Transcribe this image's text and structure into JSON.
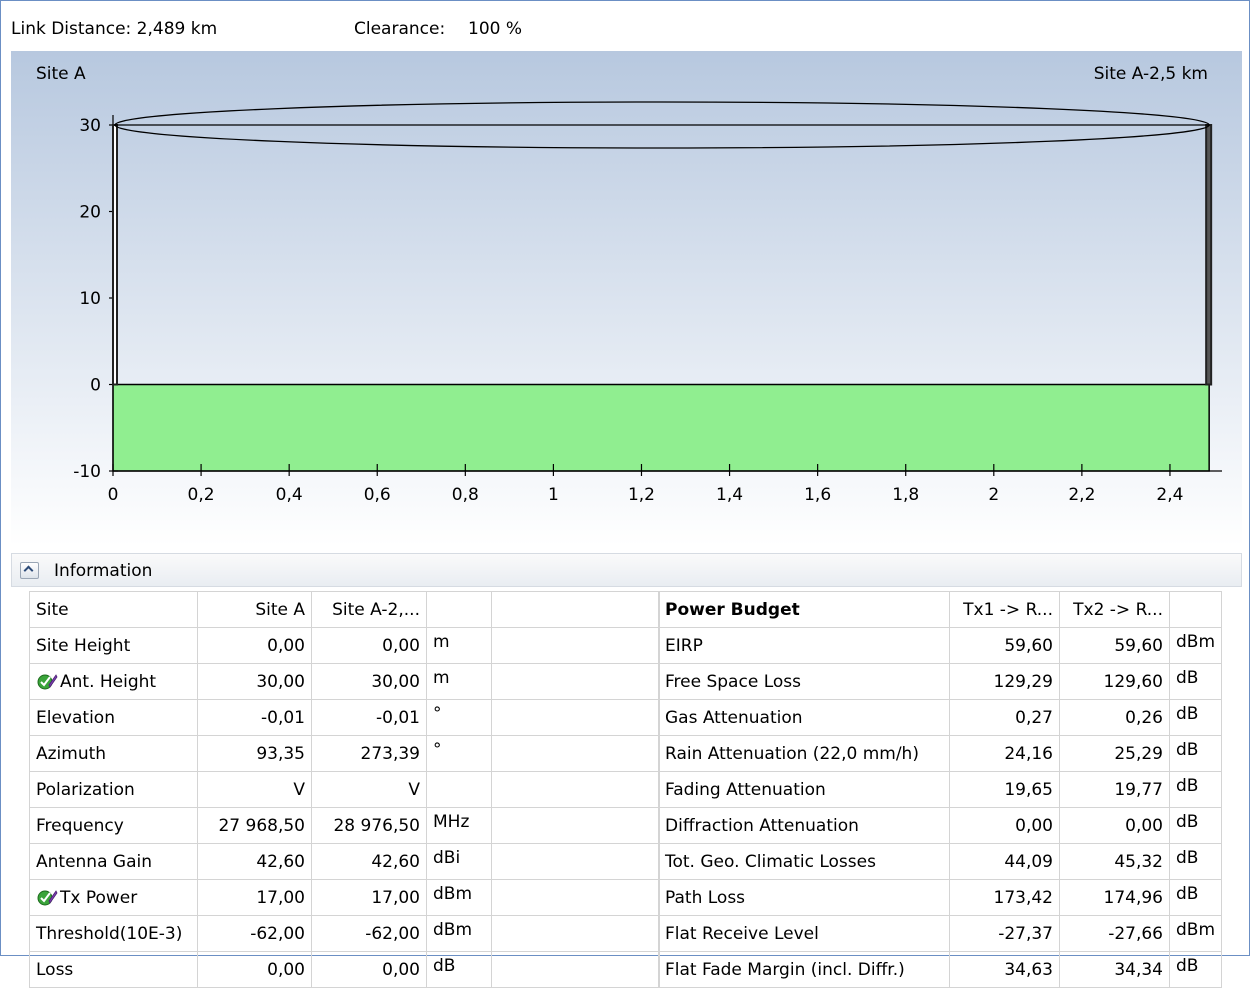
{
  "header": {
    "link_distance": "Link Distance: 2,489 km",
    "clearance_label": "Clearance:",
    "clearance_value": "100 %"
  },
  "chart_data": {
    "type": "area",
    "site_left_label": "Site A",
    "site_right_label": "Site A-2,5 km",
    "x_ticks": [
      "0",
      "0,2",
      "0,4",
      "0,6",
      "0,8",
      "1",
      "1,2",
      "1,4",
      "1,6",
      "1,8",
      "2",
      "2,2",
      "2,4"
    ],
    "y_ticks": [
      "30",
      "20",
      "10",
      "0",
      "-10"
    ],
    "xlim": [
      0,
      2.5
    ],
    "ylim": [
      -10,
      30
    ],
    "terrain": {
      "x": [
        0,
        2.489
      ],
      "y": [
        0,
        0
      ]
    },
    "antenna_height_a": 30,
    "antenna_height_b": 30,
    "link_length": 2.489,
    "colors": {
      "terrain": "#90ee90",
      "background_top": "#b7c8df",
      "background_bottom": "#ffffff"
    }
  },
  "info": {
    "title": "Information",
    "site_table": {
      "rows": [
        {
          "label": "Site",
          "a": "Site A",
          "b": "Site A-2,...",
          "unit": ""
        },
        {
          "label": "Site Height",
          "a": "0,00",
          "b": "0,00",
          "unit": "m"
        },
        {
          "label": "Ant. Height",
          "a": "30,00",
          "b": "30,00",
          "unit": "m",
          "icon": "check-edit-icon"
        },
        {
          "label": "Elevation",
          "a": "-0,01",
          "b": "-0,01",
          "unit": "°"
        },
        {
          "label": "Azimuth",
          "a": "93,35",
          "b": "273,39",
          "unit": "°"
        },
        {
          "label": "Polarization",
          "a": "V",
          "b": "V",
          "unit": ""
        },
        {
          "label": "Frequency",
          "a": "27 968,50",
          "b": "28 976,50",
          "unit": "MHz"
        },
        {
          "label": "Antenna Gain",
          "a": "42,60",
          "b": "42,60",
          "unit": "dBi"
        },
        {
          "label": "Tx Power",
          "a": "17,00",
          "b": "17,00",
          "unit": "dBm",
          "icon": "check-edit-icon"
        },
        {
          "label": "Threshold(10E-3)",
          "a": "-62,00",
          "b": "-62,00",
          "unit": "dBm"
        },
        {
          "label": "Loss",
          "a": "0,00",
          "b": "0,00",
          "unit": "dB"
        }
      ]
    },
    "power_table": {
      "rows": [
        {
          "label": "Power Budget",
          "a": "Tx1 -> R...",
          "b": "Tx2 -> R...",
          "unit": ""
        },
        {
          "label": "EIRP",
          "a": "59,60",
          "b": "59,60",
          "unit": "dBm"
        },
        {
          "label": "Free Space Loss",
          "a": "129,29",
          "b": "129,60",
          "unit": "dB"
        },
        {
          "label": "Gas Attenuation",
          "a": "0,27",
          "b": "0,26",
          "unit": "dB"
        },
        {
          "label": "Rain Attenuation (22,0 mm/h)",
          "a": "24,16",
          "b": "25,29",
          "unit": "dB"
        },
        {
          "label": "Fading Attenuation",
          "a": "19,65",
          "b": "19,77",
          "unit": "dB"
        },
        {
          "label": "Diffraction Attenuation",
          "a": "0,00",
          "b": "0,00",
          "unit": "dB"
        },
        {
          "label": "Tot. Geo. Climatic Losses",
          "a": "44,09",
          "b": "45,32",
          "unit": "dB"
        },
        {
          "label": "Path Loss",
          "a": "173,42",
          "b": "174,96",
          "unit": "dB"
        },
        {
          "label": "Flat Receive Level",
          "a": "-27,37",
          "b": "-27,66",
          "unit": "dBm"
        },
        {
          "label": "Flat Fade Margin (incl. Diffr.)",
          "a": "34,63",
          "b": "34,34",
          "unit": "dB"
        }
      ]
    }
  }
}
